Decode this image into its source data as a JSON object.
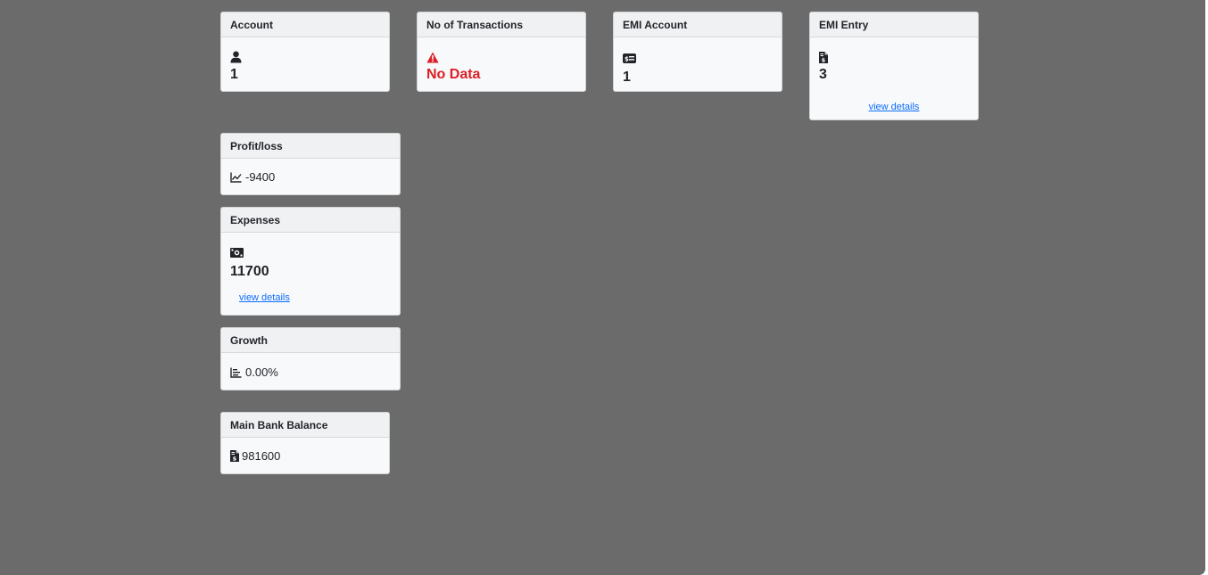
{
  "cards": {
    "account": {
      "title": "Account",
      "icon": "user-icon",
      "value": "1"
    },
    "transactions": {
      "title": "No of Transactions",
      "icon": "warning-icon",
      "value": "No Data",
      "color": "#dc1f26"
    },
    "emi_account": {
      "title": "EMI Account",
      "icon": "money-card-icon",
      "value": "1"
    },
    "emi_entry": {
      "title": "EMI Entry",
      "icon": "invoice-icon",
      "value": "3",
      "link": "view details"
    },
    "profit_loss": {
      "title": "Profit/loss",
      "icon": "line-chart-icon",
      "value": "-9400"
    },
    "expenses": {
      "title": "Expenses",
      "icon": "cash-icon",
      "value": "11700",
      "link": "view details"
    },
    "growth": {
      "title": "Growth",
      "icon": "bar-chart-icon",
      "value": "0.00%"
    },
    "bank_balance": {
      "title": "Main Bank Balance",
      "icon": "receipt-icon",
      "value": "981600"
    }
  },
  "colors": {
    "background": "#6b6b6b",
    "card": "#f8f9fa",
    "link": "#0d6efd",
    "alert": "#dc1f26"
  }
}
